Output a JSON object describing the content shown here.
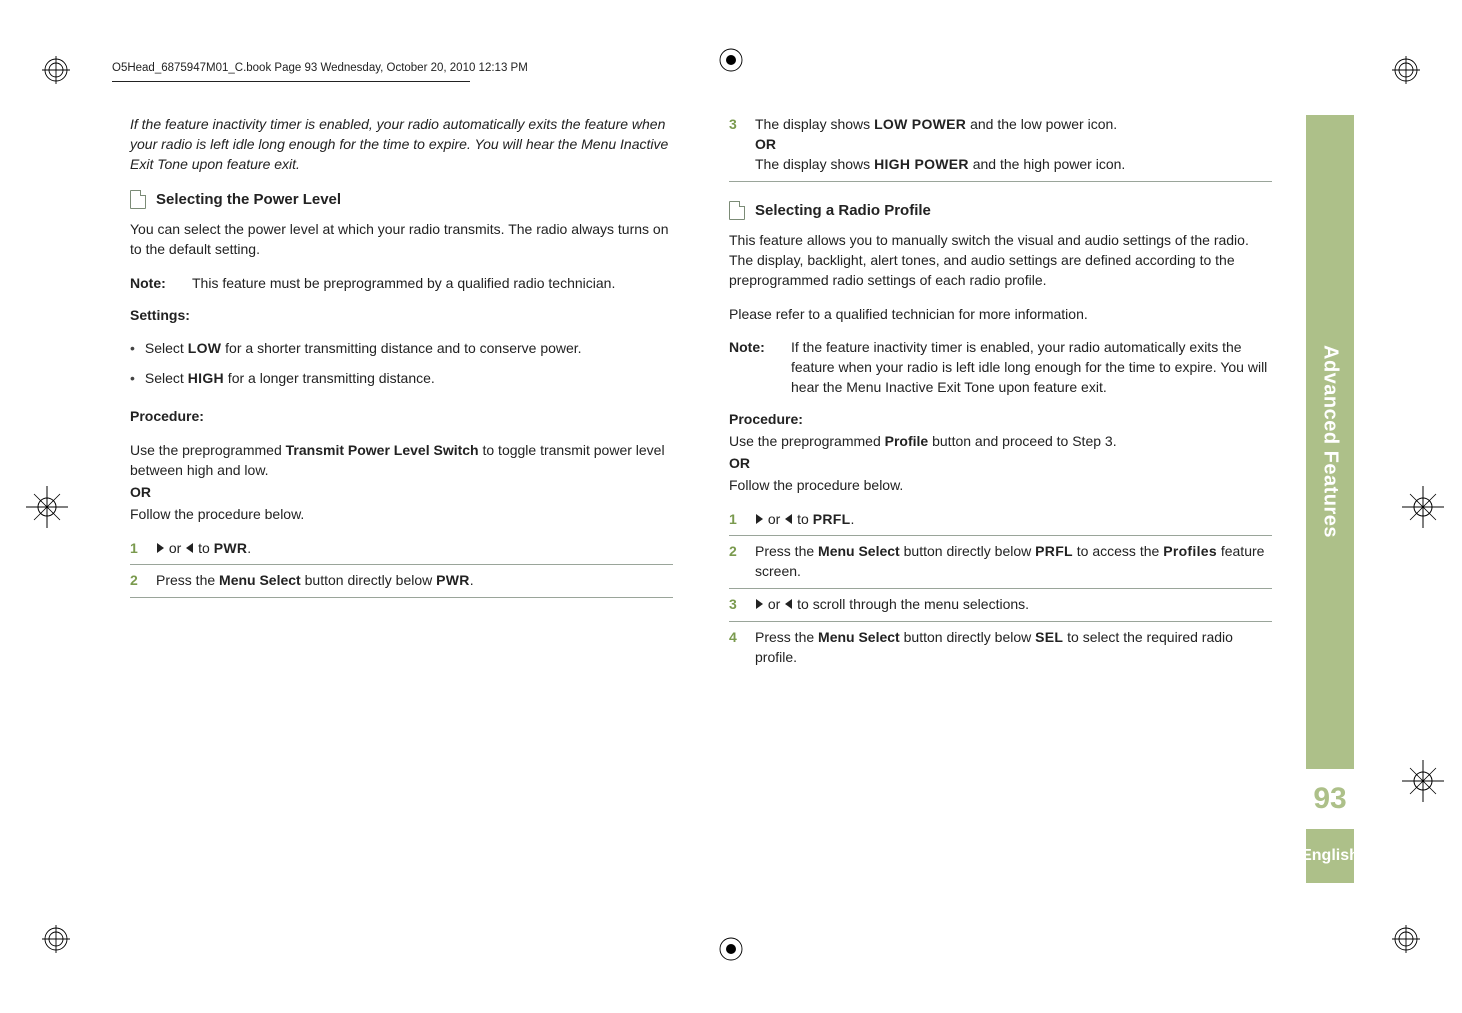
{
  "header": "O5Head_6875947M01_C.book  Page 93  Wednesday, October 20, 2010  12:13 PM",
  "side": {
    "section": "Advanced Features",
    "page": "93",
    "lang": "English"
  },
  "left": {
    "intro_italic": "If the feature inactivity timer is enabled, your radio automatically exits the feature when your radio is left idle long enough for the time to expire. You will hear the Menu Inactive Exit Tone upon feature exit.",
    "h_power": "Selecting the Power Level",
    "p_power1": "You can select the power level at which your radio transmits. The radio always turns on to the default setting.",
    "note_lbl": "Note:",
    "note_body": "This feature must be preprogrammed by a qualified radio technician.",
    "settings_hdr": "Settings:",
    "bullet1_a": "Select ",
    "bullet1_lcd": "LOW",
    "bullet1_b": " for a shorter transmitting distance and to conserve power.",
    "bullet2_a": "Select ",
    "bullet2_lcd": "HIGH",
    "bullet2_b": " for a longer transmitting distance.",
    "proc_hdr": "Procedure:",
    "proc_p1_a": "Use the preprogrammed ",
    "proc_p1_b": "Transmit Power Level Switch",
    "proc_p1_c": " to toggle transmit power level between high and low.",
    "or": "OR",
    "proc_p2": "Follow the procedure below.",
    "step1_mid": " or ",
    "step1_to": " to ",
    "step1_lcd": "PWR",
    "step1_dot": ".",
    "step2_a": "Press the ",
    "step2_b": "Menu Select",
    "step2_c": " button directly below ",
    "step2_lcd": "PWR",
    "step2_dot": "."
  },
  "right": {
    "step3_a": "The display shows ",
    "step3_lcd1": "LOW POWER",
    "step3_b": " and the low power icon.",
    "step3_or": "OR",
    "step3_c": "The display shows ",
    "step3_lcd2": "HIGH POWER",
    "step3_d": " and the high power icon.",
    "h_profile": "Selecting a Radio Profile",
    "p_profile1": "This feature allows you to manually switch the visual and audio settings of the radio. The display, backlight, alert tones, and audio settings are defined according to the preprogrammed radio settings of each radio profile.",
    "p_profile2": "Please refer to a qualified technician for more information.",
    "note_lbl": "Note:",
    "note_body": "If the feature inactivity timer is enabled, your radio automatically exits the feature when your radio is left idle long enough for the time to expire. You will hear the Menu Inactive Exit Tone upon feature exit.",
    "proc_hdr": "Procedure:",
    "proc_p1_a": "Use the preprogrammed ",
    "proc_p1_b": "Profile",
    "proc_p1_c": " button and proceed to Step 3.",
    "or": "OR",
    "proc_p2": "Follow the procedure below.",
    "s1_mid": " or ",
    "s1_to": " to ",
    "s1_lcd": "PRFL",
    "s1_dot": ".",
    "s2_a": "Press the ",
    "s2_b": "Menu Select",
    "s2_c": " button directly below ",
    "s2_lcd": "PRFL",
    "s2_d": " to access the ",
    "s2_lcd2": "Profiles",
    "s2_e": " feature screen.",
    "s3_mid": " or ",
    "s3_txt": " to scroll through the menu selections.",
    "s4_a": "Press the ",
    "s4_b": "Menu Select",
    "s4_c": " button directly below ",
    "s4_lcd": "SEL",
    "s4_d": " to select the required radio profile."
  },
  "nums": {
    "n1": "1",
    "n2": "2",
    "n3": "3",
    "n4": "4"
  }
}
